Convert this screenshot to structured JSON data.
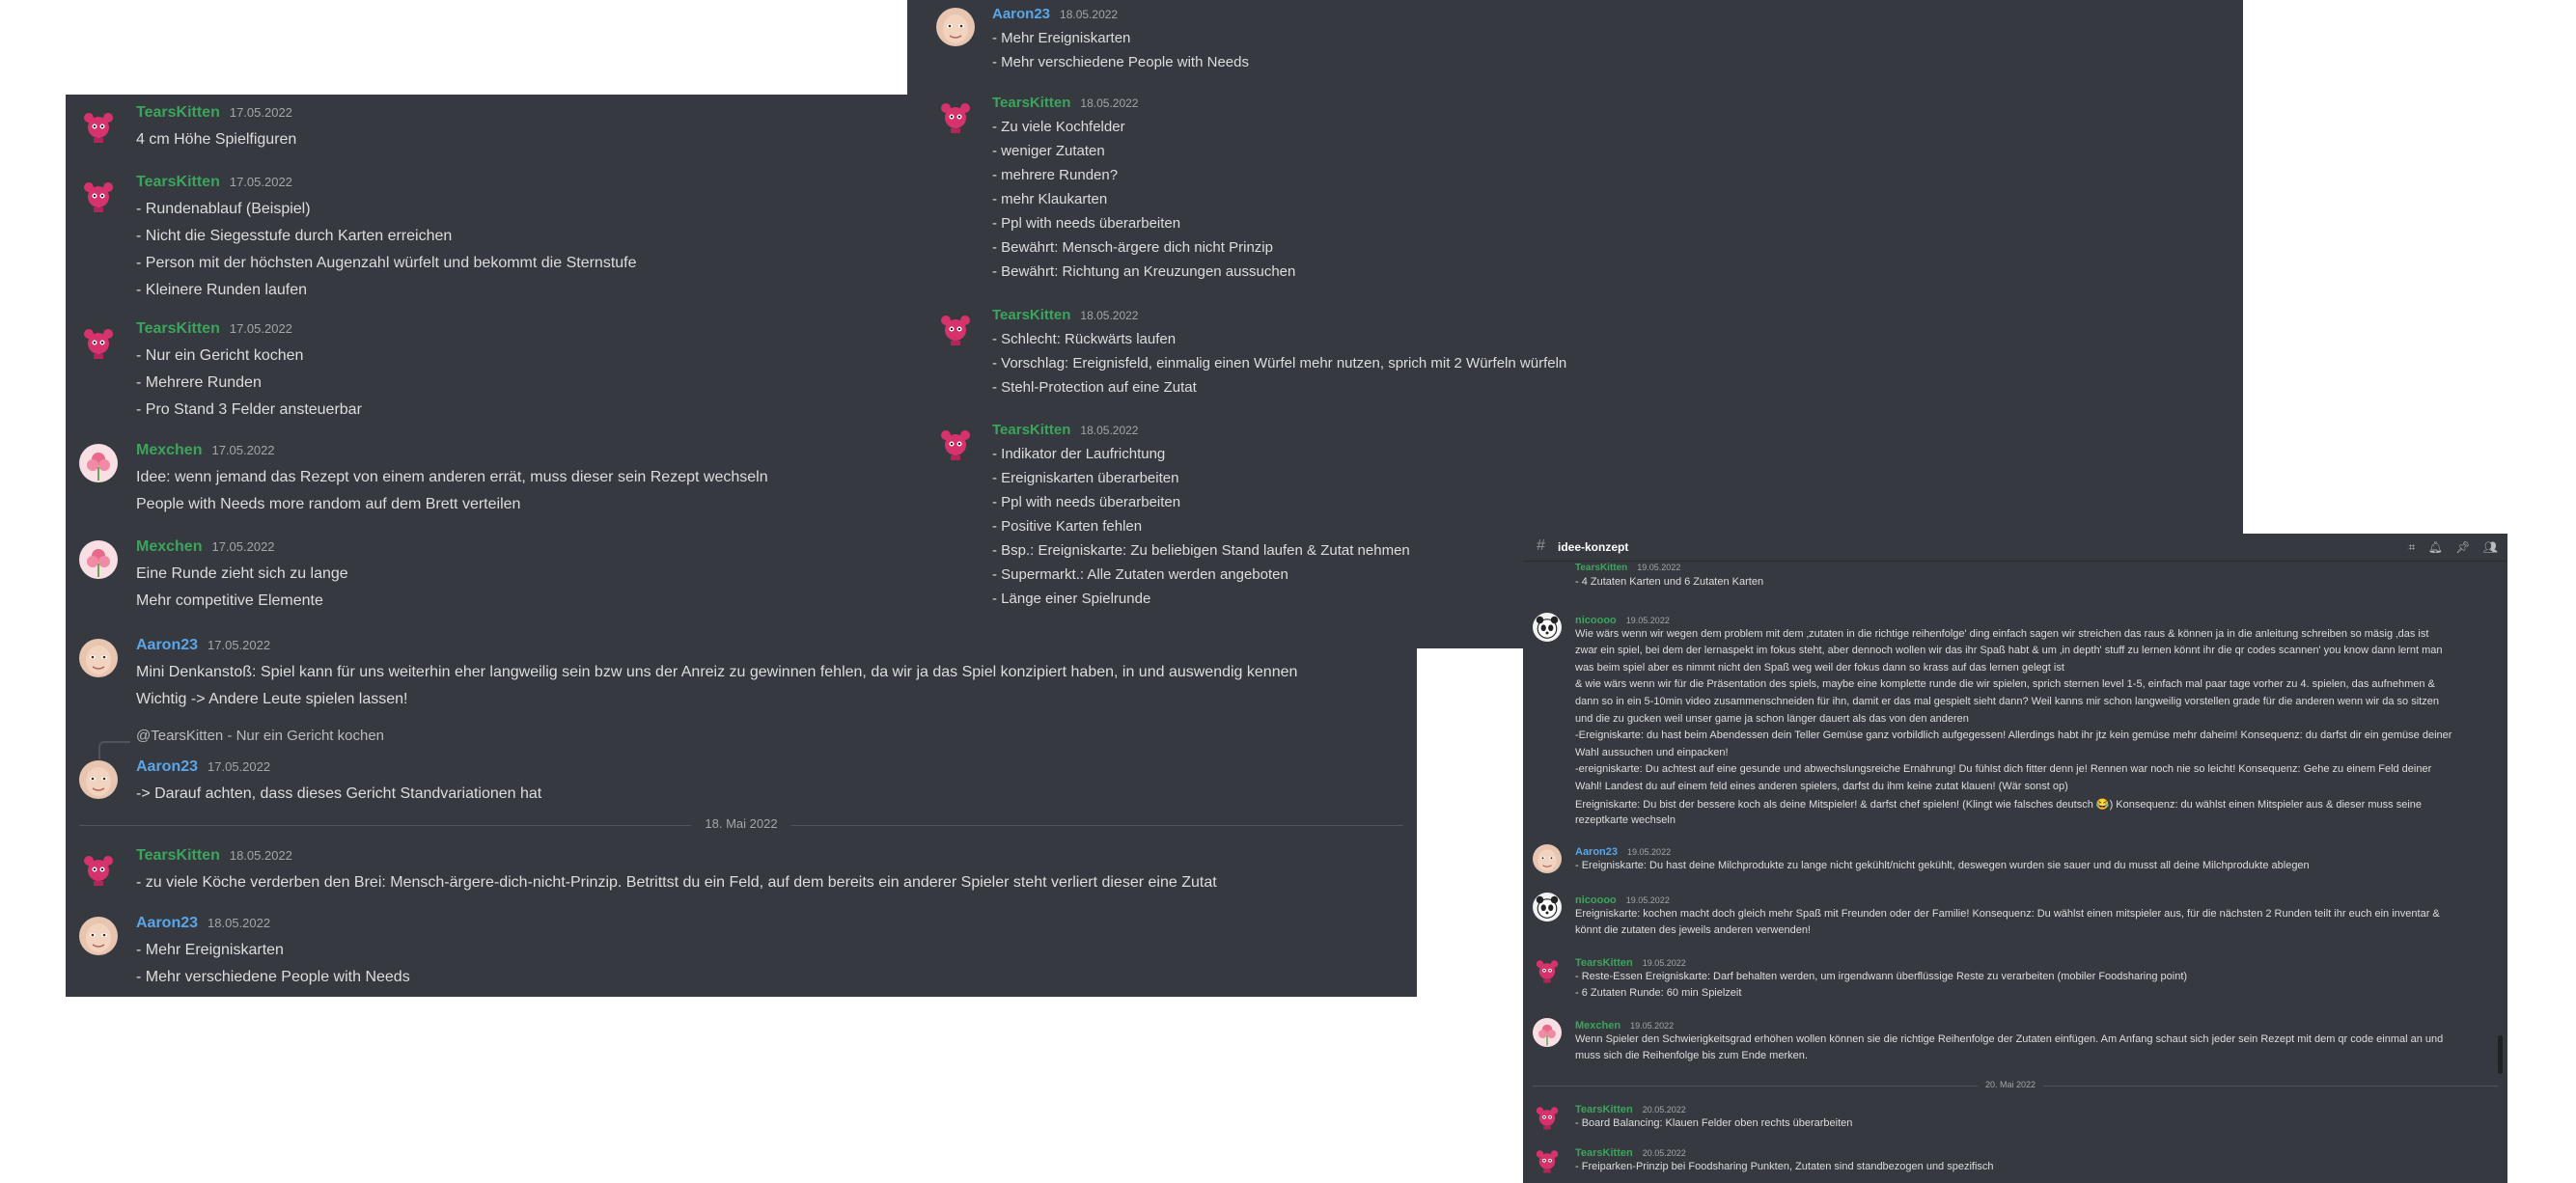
{
  "colors": {
    "bg": "#36393f",
    "green_user": "#3ba55c",
    "blue_user": "#5aa6e8",
    "text": "#dcddde",
    "muted": "#a3a6aa"
  },
  "panel1": {
    "messages": [
      {
        "user": "TearsKitten",
        "date": "17.05.2022",
        "avatar": "pink-creature-icon",
        "lines": [
          "4 cm Höhe Spielfiguren"
        ]
      },
      {
        "user": "TearsKitten",
        "date": "17.05.2022",
        "avatar": "pink-creature-icon",
        "lines": [
          "- Rundenablauf (Beispiel)",
          "- Nicht die Siegesstufe durch Karten erreichen",
          "- Person mit der höchsten Augenzahl würfelt und bekommt die Sternstufe",
          "- Kleinere Runden laufen"
        ]
      },
      {
        "user": "TearsKitten",
        "date": "17.05.2022",
        "avatar": "pink-creature-icon",
        "lines": [
          "- Nur ein Gericht kochen",
          "- Mehrere Runden",
          "- Pro Stand 3 Felder ansteuerbar"
        ]
      },
      {
        "user": "Mexchen",
        "date": "17.05.2022",
        "avatar": "pink-flower-icon",
        "lines": [
          "Idee: wenn jemand das Rezept von einem anderen errät, muss dieser sein Rezept wechseln",
          "People with Needs more random auf dem Brett verteilen"
        ]
      },
      {
        "user": "Mexchen",
        "date": "17.05.2022",
        "avatar": "pink-flower-icon",
        "lines": [
          "Eine Runde zieht sich zu lange",
          "Mehr competitive Elemente"
        ]
      },
      {
        "user": "Aaron23",
        "date": "17.05.2022",
        "avatar": "face-avatar-icon",
        "lines": [
          "Mini Denkanstoß: Spiel kann für uns weiterhin eher langweilig sein bzw uns der Anreiz zu gewinnen fehlen, da wir ja das Spiel konzipiert haben, in und auswendig kennen",
          "Wichtig -> Andere Leute spielen lassen!"
        ]
      },
      {
        "user": "Aaron23",
        "date": "17.05.2022",
        "avatar": "face-avatar-icon",
        "reply": "@TearsKitten - Nur ein Gericht kochen",
        "lines": [
          "-> Darauf achten, dass dieses Gericht Standvariationen hat"
        ]
      },
      {
        "user": "TearsKitten",
        "date": "18.05.2022",
        "avatar": "pink-creature-icon",
        "lines": [
          "- zu viele Köche verderben den Brei: Mensch-ärgere-dich-nicht-Prinzip. Betrittst du ein Feld, auf dem bereits ein anderer Spieler steht verliert dieser eine Zutat"
        ]
      },
      {
        "user": "Aaron23",
        "date": "18.05.2022",
        "avatar": "face-avatar-icon",
        "lines": [
          "- Mehr Ereigniskarten",
          "- Mehr verschiedene People with Needs"
        ]
      }
    ],
    "divider": "18. Mai 2022"
  },
  "panel2": {
    "messages": [
      {
        "user": "Aaron23",
        "date": "18.05.2022",
        "avatar": "face-avatar-icon",
        "lines": [
          "- Mehr Ereigniskarten",
          "- Mehr verschiedene People with Needs"
        ]
      },
      {
        "user": "TearsKitten",
        "date": "18.05.2022",
        "avatar": "pink-creature-icon",
        "lines": [
          "- Zu viele Kochfelder",
          "- weniger Zutaten",
          "- mehrere Runden?",
          "- mehr Klaukarten",
          "- Ppl with needs überarbeiten",
          "- Bewährt: Mensch-ärgere dich nicht Prinzip",
          "- Bewährt: Richtung an Kreuzungen aussuchen"
        ]
      },
      {
        "user": "TearsKitten",
        "date": "18.05.2022",
        "avatar": "pink-creature-icon",
        "lines": [
          "- Schlecht: Rückwärts laufen",
          "- Vorschlag: Ereignisfeld, einmalig einen Würfel mehr nutzen, sprich mit 2 Würfeln würfeln",
          "- Stehl-Protection auf eine Zutat"
        ]
      },
      {
        "user": "TearsKitten",
        "date": "18.05.2022",
        "avatar": "pink-creature-icon",
        "lines": [
          "- Indikator der Laufrichtung",
          "- Ereigniskarten überarbeiten",
          "- Ppl with needs überarbeiten",
          "- Positive Karten fehlen",
          "- Bsp.: Ereigniskarte: Zu beliebigen Stand laufen & Zutat nehmen",
          "- Supermarkt.: Alle Zutaten werden angeboten",
          "- Länge einer Spielrunde"
        ]
      }
    ]
  },
  "panel3": {
    "channel": "idee-konzept",
    "header_icons": [
      "threads-icon",
      "bell-icon",
      "pin-icon",
      "members-icon"
    ],
    "top_user": "TearsKitten",
    "top_date": "19.05.2022",
    "top_line": "- 4 Zutaten Karten und 6 Zutaten Karten",
    "messages": [
      {
        "user": "nicoooo",
        "date": "19.05.2022",
        "avatar": "panda-avatar-icon",
        "lines": [
          "Wie wärs wenn wir wegen dem problem mit dem ‚zutaten in die richtige reihenfolge' ding einfach sagen wir streichen das raus & können ja in die anleitung schreiben so mäsig ‚das ist",
          "zwar ein spiel, bei dem der lernaspekt im fokus steht, aber dennoch wollen wir das ihr Spaß habt & um ‚in depth' stuff zu lernen könnt ihr die qr codes scannen' you know dann lernt man",
          "was beim spiel aber es nimmt nicht den Spaß weg weil der fokus dann so krass auf das lernen gelegt ist",
          "& wie wärs wenn wir für die Präsentation des spiels, maybe eine komplette runde die wir spielen, sprich sternen level 1-5, einfach mal paar tage vorher zu 4. spielen, das aufnehmen &",
          "dann so in ein 5-10min video zusammenschneiden für ihn, damit er das mal gespielt sieht dann? Weil kanns mir schon langweilig vorstellen grade für die anderen wenn wir da so sitzen",
          "und die zu gucken weil unser game ja schon länger dauert als das von den anderen",
          "-Ereigniskarte: du hast beim Abendessen dein Teller Gemüse ganz vorbildlich aufgegessen! Allerdings habt ihr jtz kein gemüse mehr daheim! Konsequenz: du darfst dir ein gemüse deiner",
          "Wahl aussuchen und einpacken!",
          "-ereigniskarte: Du achtest auf eine gesunde und abwechslungsreiche Ernährung! Du fühlst dich fitter denn je! Rennen war noch nie so leicht! Konsequenz: Gehe zu einem Feld deiner",
          "Wahl! Landest du auf einem feld eines anderen spielers, darfst du ihm keine zutat klauen! (Wär sonst op)",
          "Ereigniskarte: Du bist der bessere koch als deine Mitspieler! & darfst chef spielen! (Klingt wie falsches deutsch 😂) Konsequenz: du wählst einen Mitspieler aus & dieser muss seine",
          "rezeptkarte wechseln"
        ]
      },
      {
        "user": "Aaron23",
        "date": "19.05.2022",
        "avatar": "face-avatar-icon",
        "lines": [
          "- Ereigniskarte: Du hast deine Milchprodukte zu lange nicht gekühlt/nicht gekühlt, deswegen wurden sie sauer und du musst all deine Milchprodukte ablegen"
        ]
      },
      {
        "user": "nicoooo",
        "date": "19.05.2022",
        "avatar": "panda-avatar-icon",
        "lines": [
          "Ereigniskarte: kochen macht doch gleich mehr Spaß mit Freunden oder der Familie! Konsequenz: Du wählst einen mitspieler aus, für die nächsten 2 Runden teilt ihr euch ein inventar &",
          "könnt die zutaten des jeweils anderen verwenden!"
        ]
      },
      {
        "user": "TearsKitten",
        "date": "19.05.2022",
        "avatar": "pink-creature-icon",
        "lines": [
          "- Reste-Essen Ereigniskarte: Darf behalten werden, um irgendwann überflüssige Reste zu verarbeiten (mobiler Foodsharing point)",
          "- 6 Zutaten Runde: 60 min Spielzeit"
        ]
      },
      {
        "user": "Mexchen",
        "date": "19.05.2022",
        "avatar": "pink-flower-icon",
        "lines": [
          "Wenn Spieler den Schwierigkeitsgrad erhöhen wollen können sie die richtige Reihenfolge der Zutaten einfügen. Am Anfang schaut sich jeder sein Rezept mit dem qr code einmal an und",
          "muss sich die Reihenfolge bis zum Ende merken."
        ]
      },
      {
        "user": "TearsKitten",
        "date": "20.05.2022",
        "avatar": "pink-creature-icon",
        "lines": [
          "- Board Balancing: Klauen Felder oben rechts überarbeiten"
        ]
      },
      {
        "user": "TearsKitten",
        "date": "20.05.2022",
        "avatar": "pink-creature-icon",
        "lines": [
          "- Freiparken-Prinzip bei Foodsharing Punkten, Zutaten sind standbezogen und spezifisch"
        ]
      }
    ],
    "divider": "20. Mai 2022"
  }
}
